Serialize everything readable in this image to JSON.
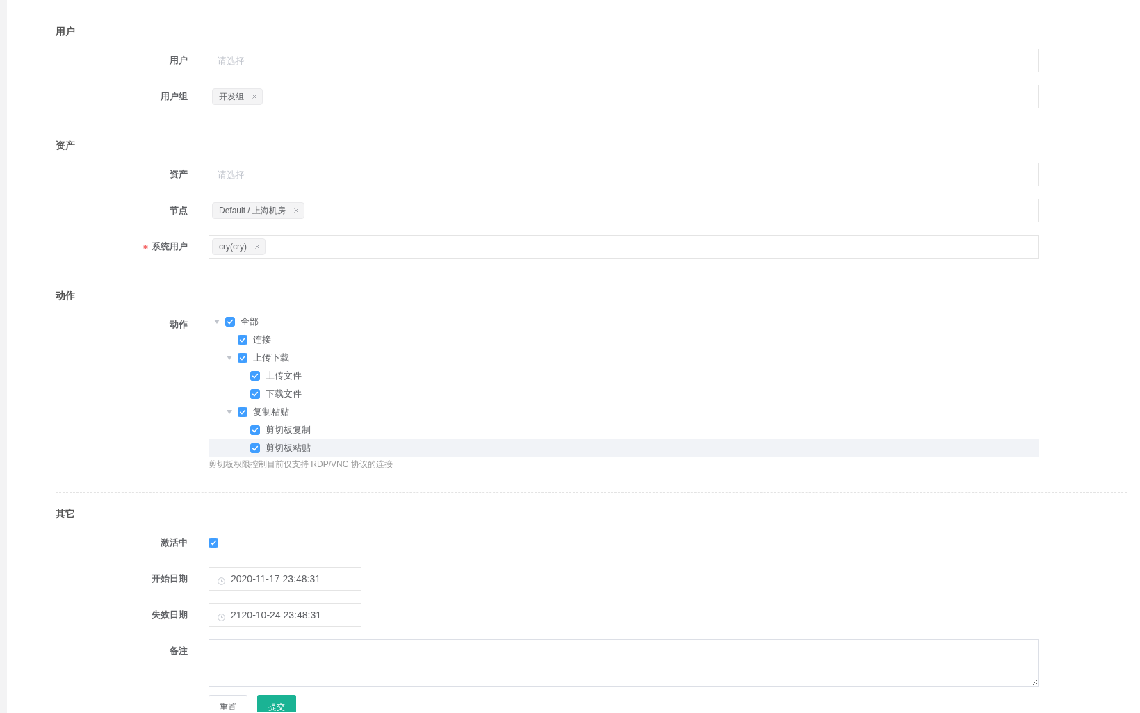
{
  "sections": [
    {
      "title": "用户",
      "fields": [
        {
          "kind": "select",
          "label": "用户",
          "required": false,
          "placeholder": "请选择"
        },
        {
          "kind": "select",
          "label": "用户组",
          "required": false,
          "tags": [
            "开发组"
          ]
        }
      ]
    },
    {
      "title": "资产",
      "fields": [
        {
          "kind": "select",
          "label": "资产",
          "required": false,
          "placeholder": "请选择"
        },
        {
          "kind": "select",
          "label": "节点",
          "required": false,
          "tags": [
            "Default / 上海机房"
          ]
        },
        {
          "kind": "select",
          "label": "系统用户",
          "required": true,
          "tags": [
            "cry(cry)"
          ]
        }
      ]
    },
    {
      "title": "动作",
      "fields": [
        {
          "kind": "tree",
          "label": "动作",
          "required": false,
          "tree": [
            {
              "label": "全部",
              "checked": true,
              "expanded": true,
              "selected": false,
              "children": [
                {
                  "label": "连接",
                  "checked": true,
                  "selected": false
                },
                {
                  "label": "上传下载",
                  "checked": true,
                  "expanded": true,
                  "selected": false,
                  "children": [
                    {
                      "label": "上传文件",
                      "checked": true,
                      "selected": false
                    },
                    {
                      "label": "下载文件",
                      "checked": true,
                      "selected": false
                    }
                  ]
                },
                {
                  "label": "复制粘贴",
                  "checked": true,
                  "expanded": true,
                  "selected": false,
                  "children": [
                    {
                      "label": "剪切板复制",
                      "checked": true,
                      "selected": false
                    },
                    {
                      "label": "剪切板粘贴",
                      "checked": true,
                      "selected": true
                    }
                  ]
                }
              ]
            }
          ],
          "hint": "剪切板权限控制目前仅支持 RDP/VNC 协议的连接"
        }
      ]
    },
    {
      "title": "其它",
      "fields": [
        {
          "kind": "checkbox",
          "label": "激活中",
          "required": false,
          "checked": true
        },
        {
          "kind": "date",
          "label": "开始日期",
          "required": false,
          "value": "2020-11-17 23:48:31"
        },
        {
          "kind": "date",
          "label": "失效日期",
          "required": false,
          "value": "2120-10-24 23:48:31"
        },
        {
          "kind": "textarea",
          "label": "备注",
          "required": false
        }
      ]
    }
  ],
  "buttons": [
    {
      "kind": "reset",
      "label": "重置"
    },
    {
      "kind": "submit",
      "label": "提交"
    }
  ]
}
